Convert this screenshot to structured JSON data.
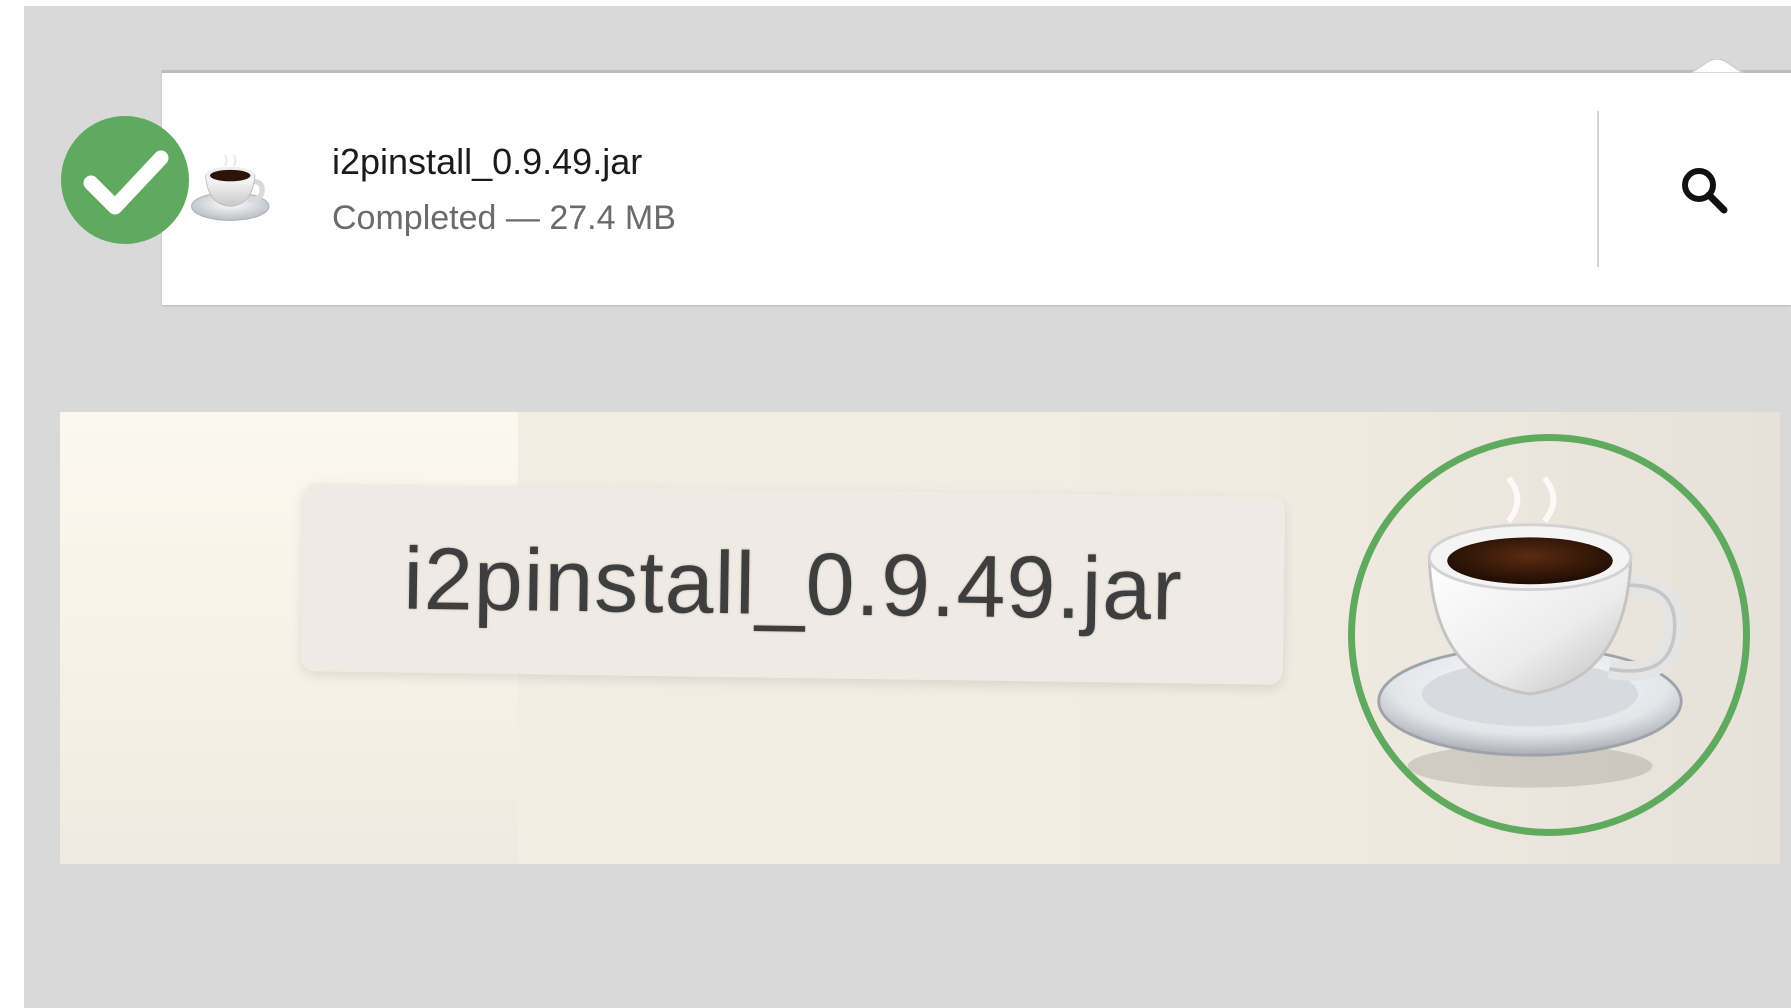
{
  "download": {
    "file_name": "i2pinstall_0.9.49.jar",
    "status": "Completed — 27.4 MB",
    "file_icon": "java-coffee-cup-icon",
    "reveal_icon": "magnifier-icon"
  },
  "badge": {
    "icon": "checkmark-icon",
    "color": "#5faa5f"
  },
  "zoom": {
    "label": "i2pinstall_0.9.49.jar",
    "icon": "java-coffee-cup-icon",
    "highlight_color": "#5faa5f"
  }
}
